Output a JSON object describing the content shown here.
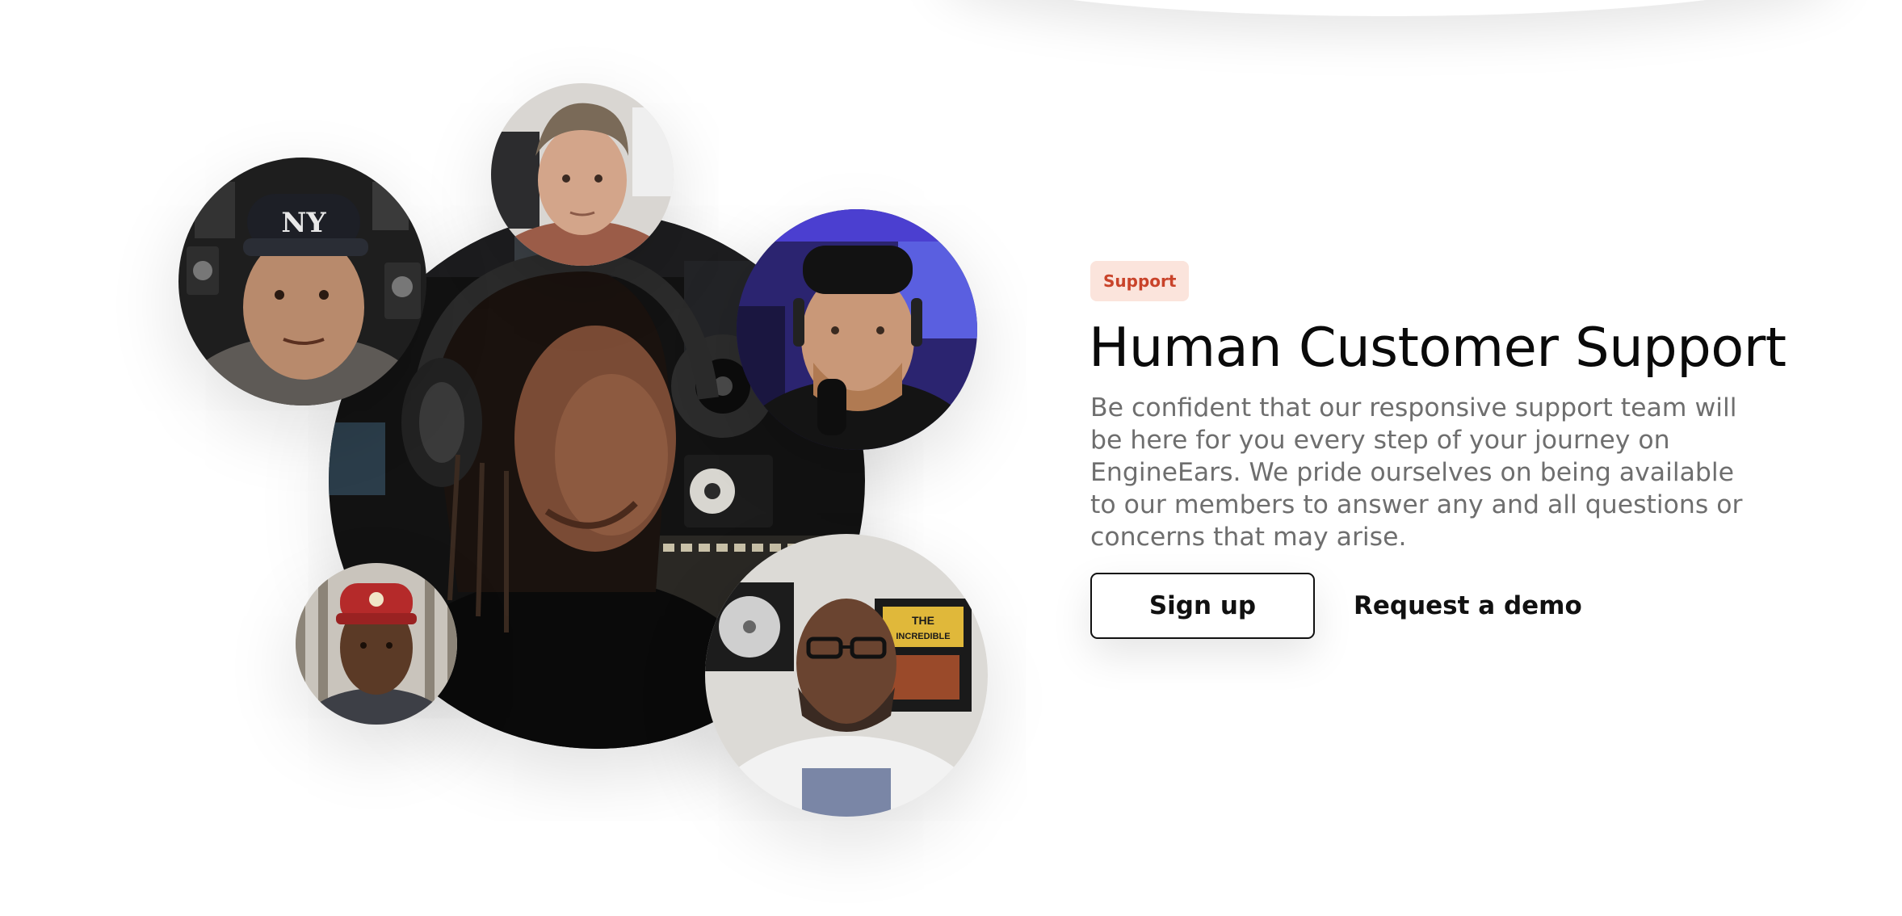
{
  "section": {
    "badge": "Support",
    "title": "Human Customer Support",
    "description": "Be confident that our responsive support team will be here for you every step of your journey on EngineEars. We pride ourselves on being available to our members to answer any and all questions or concerns that may arise."
  },
  "actions": {
    "signup_label": "Sign up",
    "demo_label": "Request a demo"
  },
  "colors": {
    "badge_bg": "#fbe4dc",
    "badge_text": "#c9432a",
    "heading": "#0a0a0a",
    "body_text": "#6e6e6e"
  },
  "collage": {
    "photos": [
      "engineer-in-studio-with-headphones",
      "man-in-ny-cap",
      "man-at-desk",
      "man-with-microphone-purple-room",
      "young-man-in-red-cap",
      "man-with-glasses-and-plaques"
    ]
  }
}
